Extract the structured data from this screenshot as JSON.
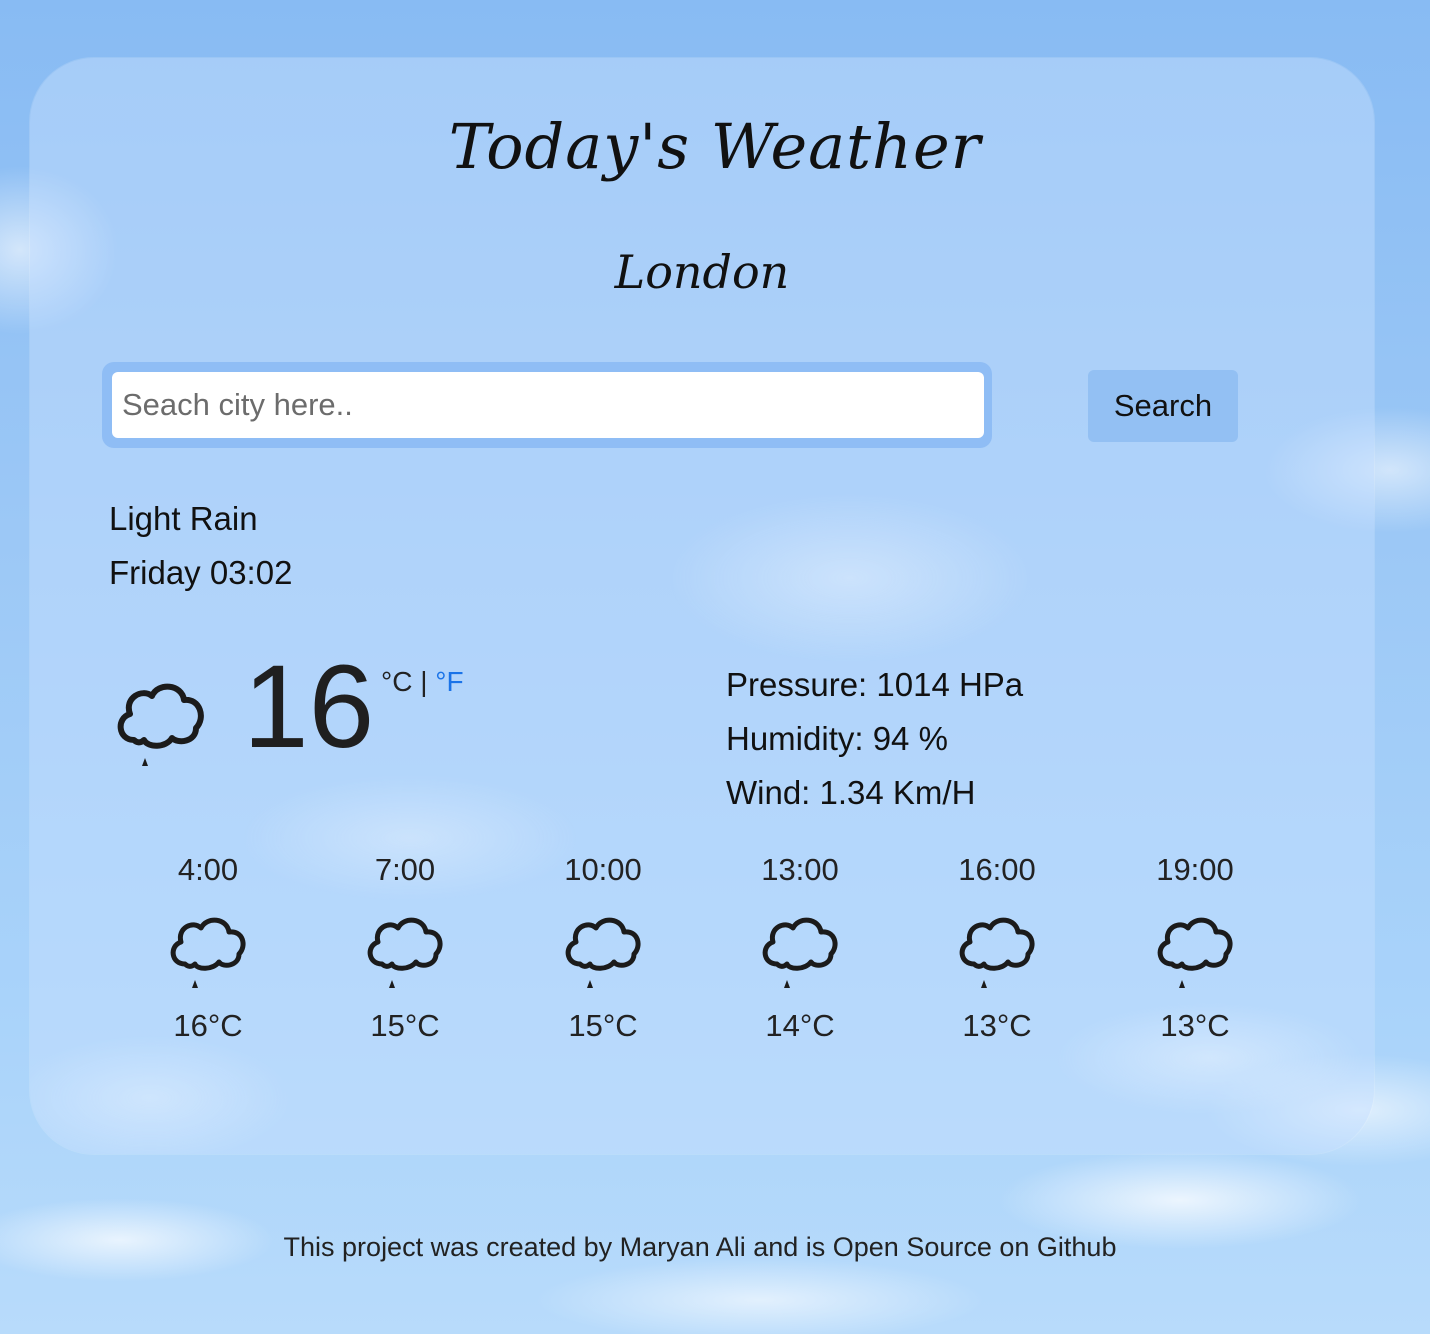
{
  "header": {
    "title": "Today's Weather",
    "city": "London"
  },
  "search": {
    "placeholder": "Seach city here..",
    "value": "",
    "button_label": "Search"
  },
  "current": {
    "condition": "Light Rain",
    "datetime": "Friday 03:02",
    "temperature": "16",
    "unit_celsius": "°C",
    "unit_separator": "|",
    "unit_fahrenheit": "°F",
    "icon": "rain-cloud-icon",
    "pressure": "Pressure: 1014 HPa",
    "humidity": "Humidity: 94 %",
    "wind": "Wind: 1.34 Km/H"
  },
  "forecast": [
    {
      "time": "4:00",
      "temp": "16°C",
      "icon": "rain-cloud-icon"
    },
    {
      "time": "7:00",
      "temp": "15°C",
      "icon": "rain-cloud-icon"
    },
    {
      "time": "10:00",
      "temp": "15°C",
      "icon": "rain-cloud-icon"
    },
    {
      "time": "13:00",
      "temp": "14°C",
      "icon": "rain-cloud-icon"
    },
    {
      "time": "16:00",
      "temp": "13°C",
      "icon": "rain-cloud-icon"
    },
    {
      "time": "19:00",
      "temp": "13°C",
      "icon": "rain-cloud-icon"
    }
  ],
  "footer": {
    "text": "This project was created by Maryan Ali and is Open Source on Github"
  },
  "colors": {
    "accent_link": "#1a73e8",
    "button_bg": "#93c0f3",
    "input_border": "#8fbdf5"
  }
}
